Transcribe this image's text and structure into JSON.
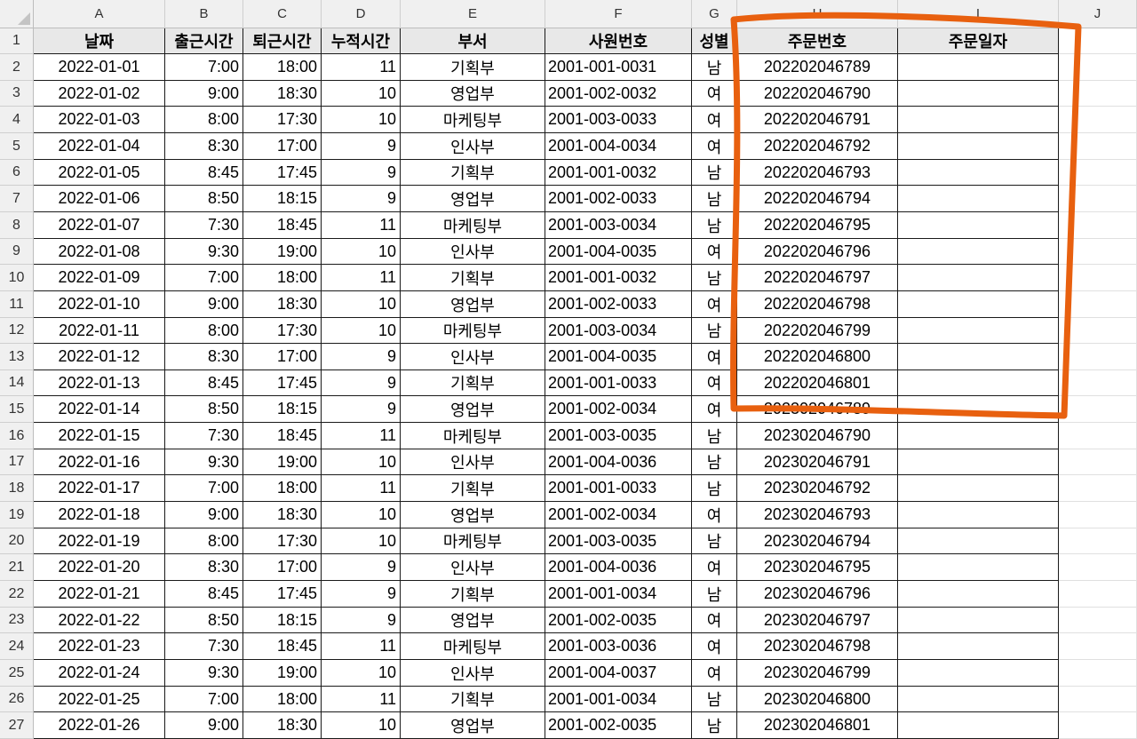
{
  "columns": [
    "A",
    "B",
    "C",
    "D",
    "E",
    "F",
    "G",
    "H",
    "I",
    "J"
  ],
  "headers": [
    "날짜",
    "출근시간",
    "퇴근시간",
    "누적시간",
    "부서",
    "사원번호",
    "성별",
    "주문번호",
    "주문일자"
  ],
  "rows": [
    [
      "2022-01-01",
      "7:00",
      "18:00",
      "11",
      "기획부",
      "2001-001-0031",
      "남",
      "202202046789",
      ""
    ],
    [
      "2022-01-02",
      "9:00",
      "18:30",
      "10",
      "영업부",
      "2001-002-0032",
      "여",
      "202202046790",
      ""
    ],
    [
      "2022-01-03",
      "8:00",
      "17:30",
      "10",
      "마케팅부",
      "2001-003-0033",
      "여",
      "202202046791",
      ""
    ],
    [
      "2022-01-04",
      "8:30",
      "17:00",
      "9",
      "인사부",
      "2001-004-0034",
      "여",
      "202202046792",
      ""
    ],
    [
      "2022-01-05",
      "8:45",
      "17:45",
      "9",
      "기획부",
      "2001-001-0032",
      "남",
      "202202046793",
      ""
    ],
    [
      "2022-01-06",
      "8:50",
      "18:15",
      "9",
      "영업부",
      "2001-002-0033",
      "남",
      "202202046794",
      ""
    ],
    [
      "2022-01-07",
      "7:30",
      "18:45",
      "11",
      "마케팅부",
      "2001-003-0034",
      "남",
      "202202046795",
      ""
    ],
    [
      "2022-01-08",
      "9:30",
      "19:00",
      "10",
      "인사부",
      "2001-004-0035",
      "여",
      "202202046796",
      ""
    ],
    [
      "2022-01-09",
      "7:00",
      "18:00",
      "11",
      "기획부",
      "2001-001-0032",
      "남",
      "202202046797",
      ""
    ],
    [
      "2022-01-10",
      "9:00",
      "18:30",
      "10",
      "영업부",
      "2001-002-0033",
      "여",
      "202202046798",
      ""
    ],
    [
      "2022-01-11",
      "8:00",
      "17:30",
      "10",
      "마케팅부",
      "2001-003-0034",
      "남",
      "202202046799",
      ""
    ],
    [
      "2022-01-12",
      "8:30",
      "17:00",
      "9",
      "인사부",
      "2001-004-0035",
      "여",
      "202202046800",
      ""
    ],
    [
      "2022-01-13",
      "8:45",
      "17:45",
      "9",
      "기획부",
      "2001-001-0033",
      "여",
      "202202046801",
      ""
    ],
    [
      "2022-01-14",
      "8:50",
      "18:15",
      "9",
      "영업부",
      "2001-002-0034",
      "여",
      "202302046789",
      ""
    ],
    [
      "2022-01-15",
      "7:30",
      "18:45",
      "11",
      "마케팅부",
      "2001-003-0035",
      "남",
      "202302046790",
      ""
    ],
    [
      "2022-01-16",
      "9:30",
      "19:00",
      "10",
      "인사부",
      "2001-004-0036",
      "남",
      "202302046791",
      ""
    ],
    [
      "2022-01-17",
      "7:00",
      "18:00",
      "11",
      "기획부",
      "2001-001-0033",
      "남",
      "202302046792",
      ""
    ],
    [
      "2022-01-18",
      "9:00",
      "18:30",
      "10",
      "영업부",
      "2001-002-0034",
      "여",
      "202302046793",
      ""
    ],
    [
      "2022-01-19",
      "8:00",
      "17:30",
      "10",
      "마케팅부",
      "2001-003-0035",
      "남",
      "202302046794",
      ""
    ],
    [
      "2022-01-20",
      "8:30",
      "17:00",
      "9",
      "인사부",
      "2001-004-0036",
      "여",
      "202302046795",
      ""
    ],
    [
      "2022-01-21",
      "8:45",
      "17:45",
      "9",
      "기획부",
      "2001-001-0034",
      "남",
      "202302046796",
      ""
    ],
    [
      "2022-01-22",
      "8:50",
      "18:15",
      "9",
      "영업부",
      "2001-002-0035",
      "여",
      "202302046797",
      ""
    ],
    [
      "2022-01-23",
      "7:30",
      "18:45",
      "11",
      "마케팅부",
      "2001-003-0036",
      "여",
      "202302046798",
      ""
    ],
    [
      "2022-01-24",
      "9:30",
      "19:00",
      "10",
      "인사부",
      "2001-004-0037",
      "여",
      "202302046799",
      ""
    ],
    [
      "2022-01-25",
      "7:00",
      "18:00",
      "11",
      "기획부",
      "2001-001-0034",
      "남",
      "202302046800",
      ""
    ],
    [
      "2022-01-26",
      "9:00",
      "18:30",
      "10",
      "영업부",
      "2001-002-0035",
      "남",
      "202302046801",
      ""
    ]
  ],
  "colors": {
    "annotation": "#e8600f",
    "header_fill": "#e8e8e8",
    "gridline": "#1a1a1a"
  },
  "annotation": {
    "shape": "hand-drawn-rectangle",
    "covers": "H1:I14"
  }
}
